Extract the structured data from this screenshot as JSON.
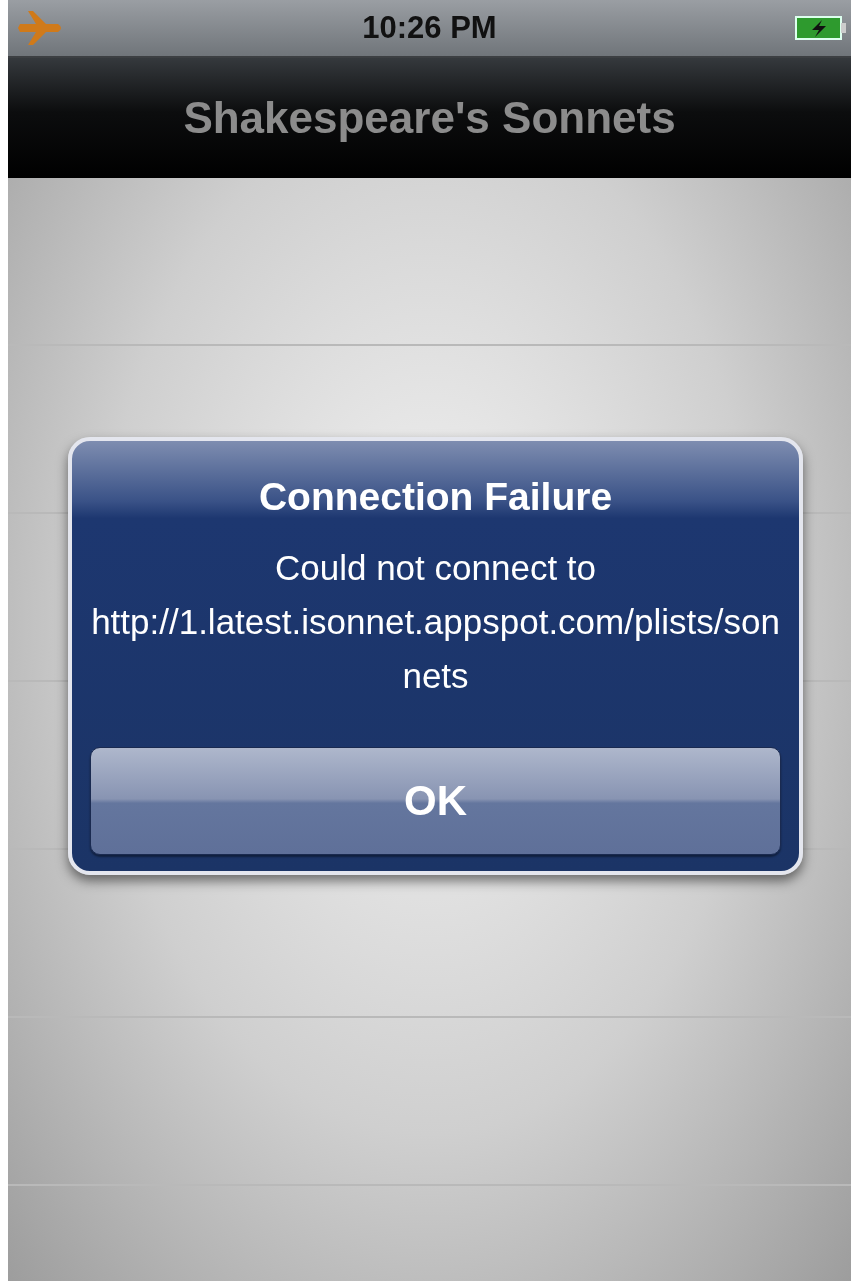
{
  "status_bar": {
    "time": "10:26 PM"
  },
  "nav_bar": {
    "title": "Shakespeare's Sonnets"
  },
  "alert": {
    "title": "Connection Failure",
    "message": "Could not connect to http://1.latest.isonnet.appspot.com/plists/sonnets",
    "buttons": [
      "OK"
    ]
  }
}
